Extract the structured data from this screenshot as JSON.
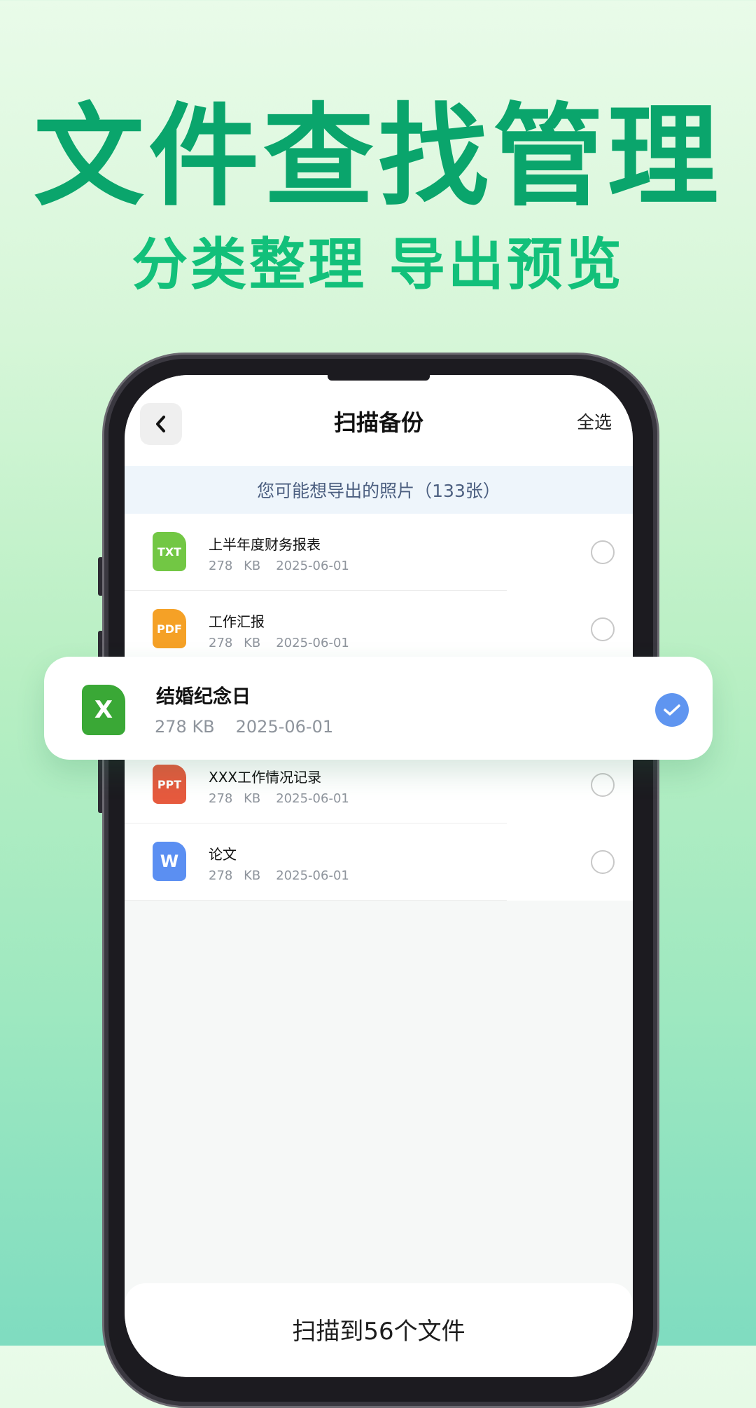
{
  "hero": {
    "title": "文件查找管理",
    "subtitle": "分类整理 导出预览"
  },
  "header": {
    "title": "扫描备份",
    "select_all": "全选",
    "back_icon": "chevron-left-icon"
  },
  "banner": {
    "text": "您可能想导出的照片（133张）"
  },
  "files": [
    {
      "name": "上半年度财务报表",
      "size": "278 KB",
      "date": "2025-06-01",
      "type_label": "TXT",
      "color": "#72c744",
      "checked": false
    },
    {
      "name": "工作汇报",
      "size": "278 KB",
      "date": "2025-06-01",
      "type_label": "PDF",
      "color": "#f5a126",
      "checked": false
    },
    {
      "name": "结婚纪念日",
      "size": "278 KB",
      "date": "2025-06-01",
      "type_label": "X",
      "color": "#3aa836",
      "checked": true
    },
    {
      "name": "XXX工作情况记录",
      "size": "278 KB",
      "date": "2025-06-01",
      "type_label": "PPT",
      "color": "#e65a3e",
      "checked": false
    },
    {
      "name": "论文",
      "size": "278 KB",
      "date": "2025-06-01",
      "type_label": "W",
      "color": "#5b8ff2",
      "checked": false
    }
  ],
  "footer": {
    "scan_count": "扫描到56个文件"
  },
  "colors": {
    "brand_green": "#0aa56c",
    "check_blue": "#5f95f0"
  }
}
